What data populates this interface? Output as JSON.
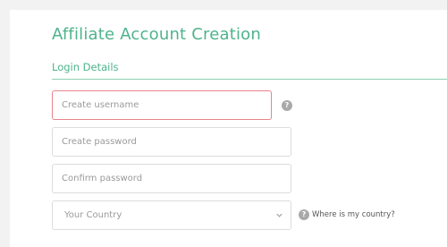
{
  "page": {
    "title": "Affiliate Account Creation"
  },
  "section": {
    "title": "Login Details"
  },
  "form": {
    "username": {
      "placeholder": "Create username",
      "value": "",
      "state": "error"
    },
    "password": {
      "placeholder": "Create password",
      "value": ""
    },
    "confirm_password": {
      "placeholder": "Confirm password",
      "value": ""
    },
    "country": {
      "selected": "Your Country"
    }
  },
  "help": {
    "icon_glyph": "?",
    "country_link": "Where is my country?"
  },
  "colors": {
    "accent": "#4fb38c",
    "error_border": "#e8838b",
    "help_icon": "#a9a9a9"
  }
}
